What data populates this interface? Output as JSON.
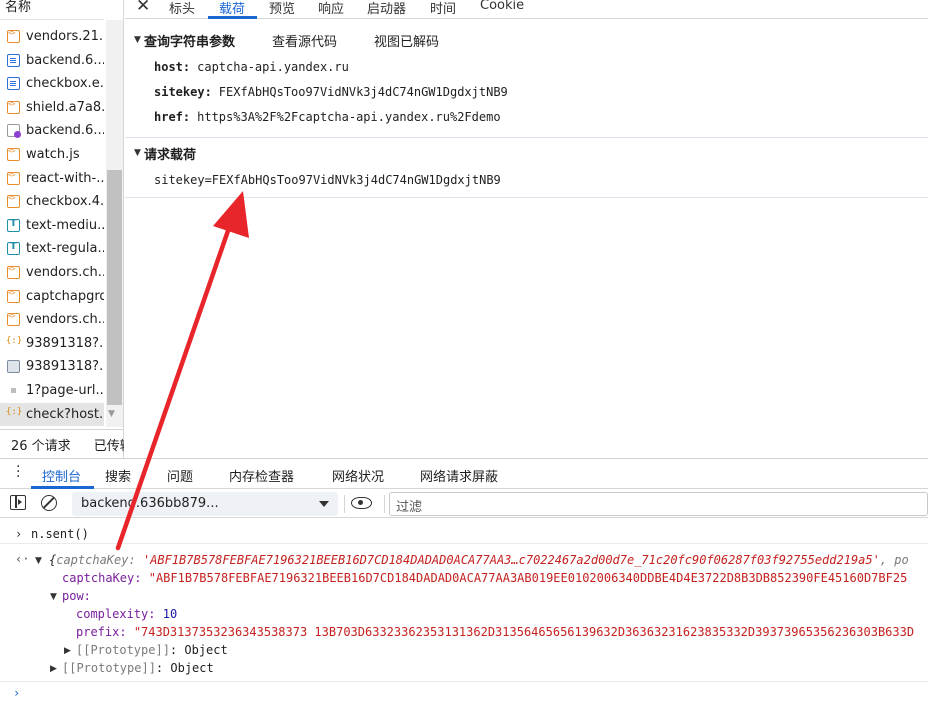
{
  "requests": {
    "header": "名称",
    "items": [
      {
        "icon": "js",
        "name": "vendors.21..."
      },
      {
        "icon": "doc",
        "name": "backend.6..."
      },
      {
        "icon": "doc",
        "name": "checkbox.e..."
      },
      {
        "icon": "js",
        "name": "shield.a7a8..."
      },
      {
        "icon": "file",
        "name": "backend.6..."
      },
      {
        "icon": "js",
        "name": "watch.js"
      },
      {
        "icon": "js",
        "name": "react-with-..."
      },
      {
        "icon": "js",
        "name": "checkbox.4..."
      },
      {
        "icon": "font",
        "name": "text-mediu..."
      },
      {
        "icon": "font",
        "name": "text-regula..."
      },
      {
        "icon": "js",
        "name": "vendors.ch..."
      },
      {
        "icon": "js",
        "name": "captchapgrd"
      },
      {
        "icon": "js",
        "name": "vendors.ch..."
      },
      {
        "icon": "json",
        "name": "93891318?..."
      },
      {
        "icon": "img",
        "name": "93891318?..."
      },
      {
        "icon": "dot",
        "name": "1?page-url..."
      },
      {
        "icon": "json",
        "name": "check?host..."
      }
    ],
    "selected_index": 16,
    "status": {
      "count": "26 个请求",
      "transferred": "已传输"
    }
  },
  "detail": {
    "tabs": [
      "标头",
      "载荷",
      "预览",
      "响应",
      "启动器",
      "时间",
      "Cookie"
    ],
    "active_tab": "载荷",
    "query_section": {
      "title": "查询字符串参数",
      "view_source": "查看源代码",
      "view_decoded": "视图已解码",
      "params": [
        {
          "key": "host:",
          "value": "captcha-api.yandex.ru"
        },
        {
          "key": "sitekey:",
          "value": "FEXfAbHQsToo97VidNVk3j4dC74nGW1DgdxjtNB9"
        },
        {
          "key": "href:",
          "value": "https%3A%2F%2Fcaptcha-api.yandex.ru%2Fdemo"
        }
      ]
    },
    "payload_section": {
      "title": "请求载荷",
      "body": "sitekey=FEXfAbHQsToo97VidNVk3j4dC74nGW1DgdxjtNB9"
    }
  },
  "drawer": {
    "tabs": [
      "控制台",
      "搜索",
      "问题",
      "内存检查器",
      "网络状况",
      "网络请求屏蔽"
    ],
    "active_tab": "控制台",
    "context": "backend.636bb879...",
    "filter_placeholder": "过滤"
  },
  "console": {
    "input": "n.sent()",
    "summary_open": "{",
    "summary_key": "captchaKey",
    "summary_colon": ": ",
    "summary_value": "'ABF1B7B578FEBFAE7196321BEEB16D7CD184DADAD0ACA77AA3…c7022467a2d00d7e_71c20fc90f06287f03f92755edd219a5'",
    "summary_tail": ", po",
    "captchaKey_label": "captchaKey:",
    "captchaKey_value": "\"ABF1B7B578FEBFAE7196321BEEB16D7CD184DADAD0ACA77AA3AB019EE0102006340DDBE4D4E3722D8B3DB852390FE45160D7BF25",
    "pow_label": "pow:",
    "complexity_label": "complexity:",
    "complexity_value": "10",
    "prefix_label": "prefix:",
    "prefix_value": "\"743D3137353236343538373 13B703D63323362353131362D31356465656139632D36363231623835332D39373965356236303B633D",
    "proto_label": "[[Prototype]]",
    "proto_value": ": Object"
  },
  "colors": {
    "accent": "#1a66d2",
    "arrow": "#e8252b",
    "string": "#c5221f",
    "key": "#7a1f9c",
    "number": "#1a1aa6"
  }
}
